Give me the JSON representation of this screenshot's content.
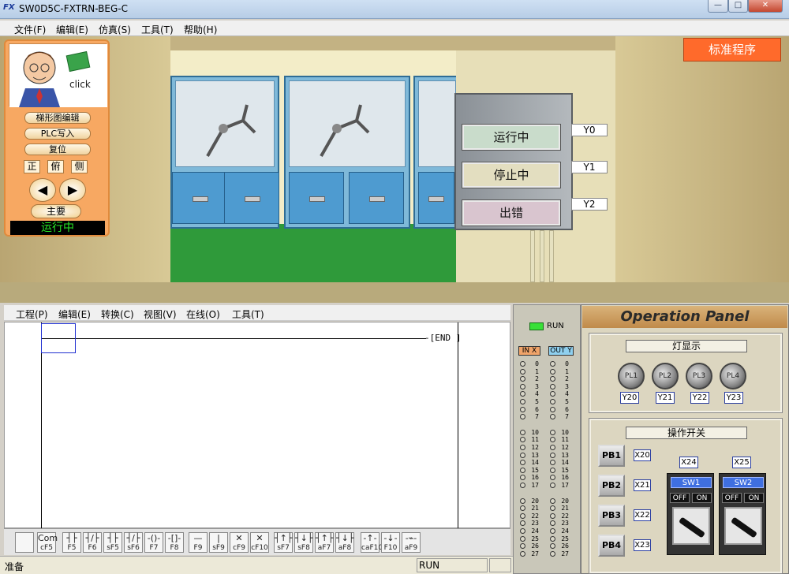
{
  "window": {
    "title": "SW0D5C-FXTRN-BEG-C",
    "app_icon": "FX"
  },
  "menu": [
    "文件(F)",
    "编辑(E)",
    "仿真(S)",
    "工具(T)",
    "帮助(H)"
  ],
  "sim": {
    "standard_program": "标准程序",
    "status_lamps": [
      {
        "label": "运行中",
        "output": "Y0",
        "color": "#c9dccb"
      },
      {
        "label": "停止中",
        "output": "Y1",
        "color": "#e3dec0"
      },
      {
        "label": "出错",
        "output": "Y2",
        "color": "#d9c5cf"
      }
    ]
  },
  "control": {
    "click": "click",
    "ladder_edit": "梯形图编辑",
    "plc_write": "PLC写入",
    "reset": "复位",
    "views": [
      "正",
      "俯",
      "侧"
    ],
    "prev": "◀",
    "next": "▶",
    "main": "主要",
    "status": "运行中"
  },
  "ladder_menu": [
    "工程(P)",
    "编辑(E)",
    "转换(C)",
    "视图(V)",
    "在线(O)",
    "工具(T)"
  ],
  "ladder": {
    "end_label": "END"
  },
  "toolbar": [
    {
      "sym": "",
      "key": ""
    },
    {
      "sym": "Com",
      "key": "cF5"
    },
    {
      "sym": "┤├",
      "key": "F5"
    },
    {
      "sym": "┤/├",
      "key": "F6"
    },
    {
      "sym": "┤├",
      "key": "sF5"
    },
    {
      "sym": "┤/├",
      "key": "sF6"
    },
    {
      "sym": "-()-",
      "key": "F7"
    },
    {
      "sym": "-[]-",
      "key": "F8"
    },
    {
      "sym": "—",
      "key": "F9"
    },
    {
      "sym": "|",
      "key": "sF9"
    },
    {
      "sym": "✕",
      "key": "cF9"
    },
    {
      "sym": "✕",
      "key": "cF10"
    },
    {
      "sym": "┤↑├",
      "key": "sF7"
    },
    {
      "sym": "┤↓├",
      "key": "sF8"
    },
    {
      "sym": "┤↑├",
      "key": "aF7"
    },
    {
      "sym": "┤↓├",
      "key": "aF8"
    },
    {
      "sym": "-↑-",
      "key": "caF10"
    },
    {
      "sym": "-↓-",
      "key": "F10"
    },
    {
      "sym": "-⌁-",
      "key": "aF9"
    }
  ],
  "status_bar": {
    "left": "准备",
    "mode": "RUN"
  },
  "io": {
    "run": "RUN",
    "in_header": "IN X",
    "out_header": "OUT Y",
    "rows": [
      "0",
      "1",
      "2",
      "3",
      "4",
      "5",
      "6",
      "7",
      "10",
      "11",
      "12",
      "13",
      "14",
      "15",
      "16",
      "17",
      "20",
      "21",
      "22",
      "23",
      "24",
      "25",
      "26",
      "27"
    ]
  },
  "operation_panel": {
    "title": "Operation Panel",
    "lights_title": "灯显示",
    "lights": [
      {
        "label": "PL1",
        "output": "Y20"
      },
      {
        "label": "PL2",
        "output": "Y21"
      },
      {
        "label": "PL3",
        "output": "Y22"
      },
      {
        "label": "PL4",
        "output": "Y23"
      }
    ],
    "switches_title": "操作开关",
    "pushbuttons": [
      {
        "label": "PB1",
        "input": "X20"
      },
      {
        "label": "PB2",
        "input": "X21"
      },
      {
        "label": "PB3",
        "input": "X22"
      },
      {
        "label": "PB4",
        "input": "X23"
      }
    ],
    "selectors": [
      {
        "label": "SW1",
        "input": "X24",
        "off": "OFF",
        "on": "ON"
      },
      {
        "label": "SW2",
        "input": "X25",
        "off": "OFF",
        "on": "ON"
      }
    ]
  }
}
